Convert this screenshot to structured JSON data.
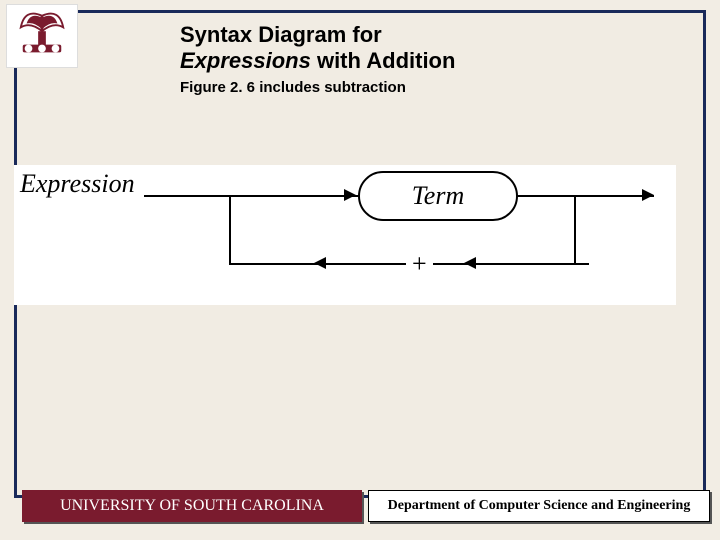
{
  "title_line1": "Syntax Diagram for",
  "title_line2_italic": "Expressions",
  "title_line2_rest": " with Addition",
  "subtitle": "Figure 2. 6 includes subtraction",
  "diagram": {
    "entry_label": "Expression",
    "node_label": "Term",
    "loop_operator": "+"
  },
  "footer": {
    "university": "UNIVERSITY OF SOUTH CAROLINA",
    "department": "Department of Computer Science and Engineering"
  },
  "colors": {
    "border": "#1a2a5a",
    "garnet": "#7a1b2e",
    "bg": "#f1ece3"
  }
}
